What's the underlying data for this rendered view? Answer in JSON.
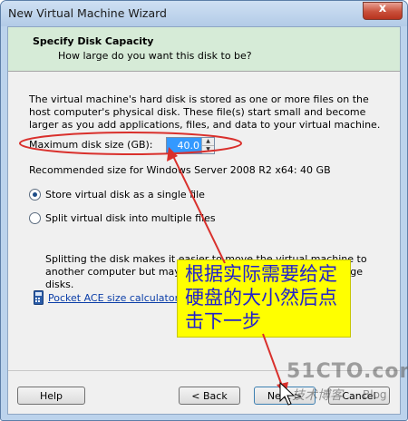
{
  "window": {
    "title": "New Virtual Machine Wizard",
    "close_glyph": "x"
  },
  "header": {
    "title": "Specify Disk Capacity",
    "subtitle": "How large do you want this disk to be?"
  },
  "content": {
    "description": "The virtual machine's hard disk is stored as one or more files on the host computer's physical disk. These file(s) start small and become larger as you add applications, files, and data to your virtual machine.",
    "max_disk_label": "Maximum disk size (GB):",
    "max_disk_value": "40.0",
    "recommended": "Recommended size for Windows Server 2008 R2 x64: 40 GB",
    "options": [
      {
        "label": "Store virtual disk as a single file",
        "selected": true
      },
      {
        "label": "Split virtual disk into multiple files",
        "selected": false
      }
    ],
    "split_note": "Splitting the disk makes it easier to move the virtual machine to another computer but may reduce performance with very large disks.",
    "calculator_link": "Pocket ACE size calculator"
  },
  "buttons": {
    "help": "Help",
    "back": "< Back",
    "next": "Next >",
    "cancel": "Cancel"
  },
  "annotation": {
    "text": "根据实际需要给定硬盘的大小然后点击下一步",
    "color": "#ffff00",
    "stroke_color": "#d9302c"
  },
  "watermark": {
    "site": "51CTO.com",
    "tagline": "技术博客",
    "blog": "Blog"
  }
}
